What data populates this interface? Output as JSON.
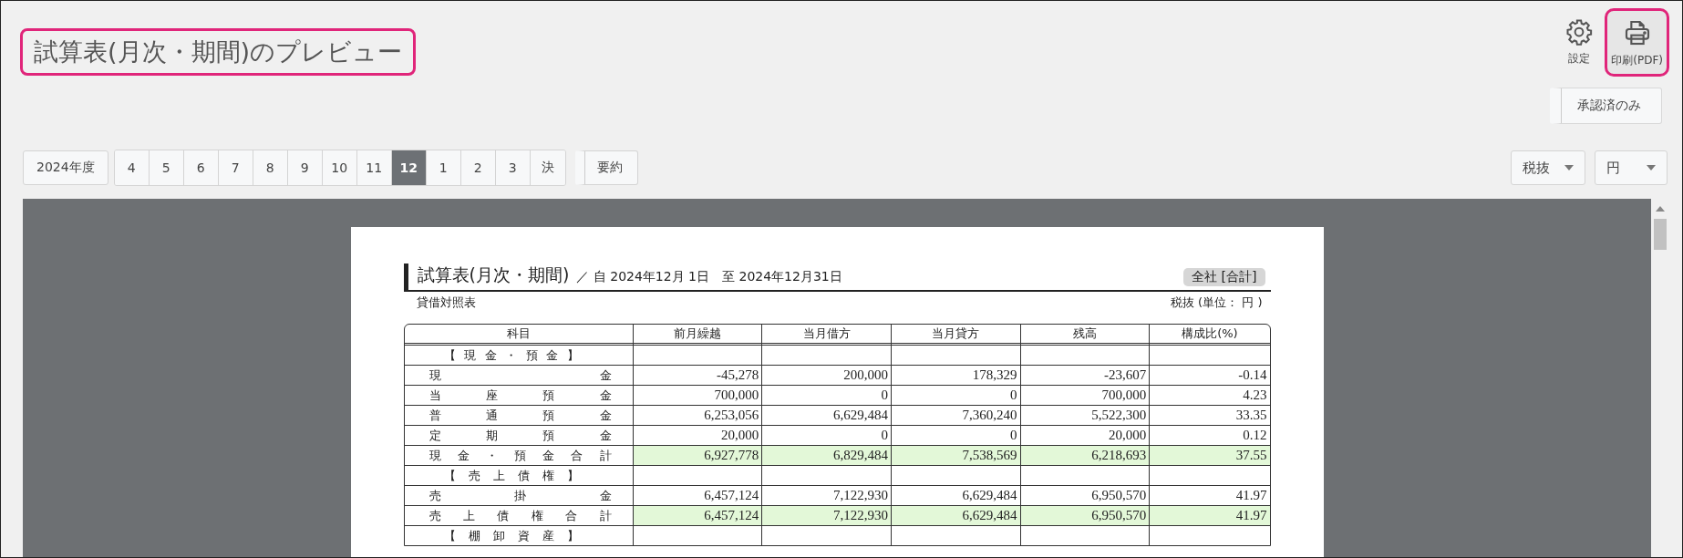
{
  "title": {
    "text": "試算表(月次・期間)のプレビュー",
    "highlighted": true
  },
  "actions": [
    {
      "kind": "settings",
      "label": "設定",
      "highlighted": false
    },
    {
      "kind": "print",
      "label": "印刷(PDF)",
      "highlighted": true
    }
  ],
  "approved_only_button": "承認済のみ",
  "fiscal_year": "2024年度",
  "months": [
    {
      "label": "4",
      "selected": false
    },
    {
      "label": "5",
      "selected": false
    },
    {
      "label": "6",
      "selected": false
    },
    {
      "label": "7",
      "selected": false
    },
    {
      "label": "8",
      "selected": false
    },
    {
      "label": "9",
      "selected": false
    },
    {
      "label": "10",
      "selected": false
    },
    {
      "label": "11",
      "selected": false
    },
    {
      "label": "12",
      "selected": true
    },
    {
      "label": "1",
      "selected": false
    },
    {
      "label": "2",
      "selected": false
    },
    {
      "label": "3",
      "selected": false
    },
    {
      "label": "決",
      "selected": false
    }
  ],
  "summary_button": "要約",
  "tax_select": "税抜",
  "unit_select": "円",
  "document": {
    "heading": "試算表(月次・期間)",
    "period": "／ 自 2024年12月 1日　至 2024年12月31日",
    "entity": "全社 [合計]",
    "subtitle": "貸借対照表",
    "unit_note": "税抜 (単位： 円 )",
    "columns": [
      "科目",
      "前月繰越",
      "当月借方",
      "当月貸方",
      "残高",
      "構成比(%)"
    ],
    "rows": [
      {
        "kind": "section",
        "account": "【現金・預金】",
        "values": []
      },
      {
        "kind": "item",
        "account": "現金",
        "values": [
          "-45,278",
          "200,000",
          "178,329",
          "-23,607",
          "-0.14"
        ]
      },
      {
        "kind": "item",
        "account": "当座預金",
        "values": [
          "700,000",
          "0",
          "0",
          "700,000",
          "4.23"
        ]
      },
      {
        "kind": "item",
        "account": "普通預金",
        "values": [
          "6,253,056",
          "6,629,484",
          "7,360,240",
          "5,522,300",
          "33.35"
        ]
      },
      {
        "kind": "item",
        "account": "定期預金",
        "values": [
          "20,000",
          "0",
          "0",
          "20,000",
          "0.12"
        ]
      },
      {
        "kind": "total",
        "account": "現金・預金合計",
        "values": [
          "6,927,778",
          "6,829,484",
          "7,538,569",
          "6,218,693",
          "37.55"
        ]
      },
      {
        "kind": "section",
        "account": "【売上債権】",
        "values": []
      },
      {
        "kind": "item",
        "account": "売掛金",
        "values": [
          "6,457,124",
          "7,122,930",
          "6,629,484",
          "6,950,570",
          "41.97"
        ]
      },
      {
        "kind": "total",
        "account": "売上債権合計",
        "values": [
          "6,457,124",
          "7,122,930",
          "6,629,484",
          "6,950,570",
          "41.97"
        ]
      },
      {
        "kind": "section",
        "account": "【棚卸資産】",
        "values": []
      }
    ]
  }
}
